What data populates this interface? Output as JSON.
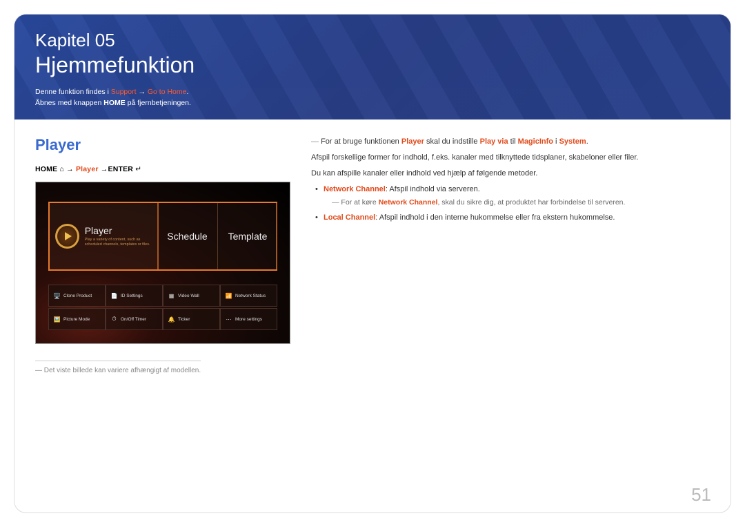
{
  "header": {
    "chapter_prefix": "Kapitel",
    "chapter_number": "05",
    "chapter_title": "Hjemmefunktion",
    "intro_pre": "Denne funktion findes i ",
    "intro_support": "Support",
    "intro_arrow": " → ",
    "intro_goto": "Go to Home",
    "intro_post": ".",
    "sub2_pre": "Åbnes med knappen ",
    "sub2_bold": "HOME",
    "sub2_post": " på fjernbetjeningen."
  },
  "left": {
    "section_title": "Player",
    "path_home": "HOME",
    "path_home_icon": "⌂",
    "path_arrow1": " → ",
    "path_player": "Player",
    "path_arrow2": " →",
    "path_enter": "ENTER",
    "path_enter_icon": "↵",
    "footnote": "Det viste billede kan variere afhængigt af modellen."
  },
  "screenshot": {
    "tiles": {
      "player_name": "Player",
      "player_desc": "Play a variety of content, such as scheduled channels, templates or files.",
      "schedule": "Schedule",
      "template": "Template"
    },
    "grid_row1": [
      {
        "icon": "🖥️",
        "color": "#4aa0e0",
        "label": "Clone Product"
      },
      {
        "icon": "📄",
        "color": "#e06a2a",
        "label": "ID Settings"
      },
      {
        "icon": "▦",
        "color": "#e0c050",
        "label": "Video Wall"
      },
      {
        "icon": "📶",
        "color": "#4a90d0",
        "label": "Network Status"
      }
    ],
    "grid_row2": [
      {
        "icon": "🖼️",
        "color": "#4aa0e0",
        "label": "Picture Mode"
      },
      {
        "icon": "⏱",
        "color": "#50b050",
        "label": "On/Off Timer"
      },
      {
        "icon": "🔔",
        "color": "#d05050",
        "label": "Ticker"
      },
      {
        "icon": "⋯",
        "color": "#9aa0a8",
        "label": "More settings"
      }
    ]
  },
  "right": {
    "note1_pre": "For at bruge funktionen ",
    "note1_player": "Player",
    "note1_mid": " skal du indstille ",
    "note1_playvia": "Play via",
    "note1_til": " til ",
    "note1_magic": "MagicInfo",
    "note1_i": " i ",
    "note1_system": "System",
    "note1_post": ".",
    "para1": "Afspil forskellige former for indhold, f.eks. kanaler med tilknyttede tidsplaner, skabeloner eller filer.",
    "para2": "Du kan afspille kanaler eller indhold ved hjælp af følgende metoder.",
    "bullet1_label": "Network Channel",
    "bullet1_text": ": Afspil indhold via serveren.",
    "bullet1_sub_pre": "For at køre ",
    "bullet1_sub_label": "Network Channel",
    "bullet1_sub_post": ", skal du sikre dig, at produktet har forbindelse til serveren.",
    "bullet2_label": "Local Channel",
    "bullet2_text": ": Afspil indhold i den interne hukommelse eller fra ekstern hukommelse."
  },
  "page_number": "51"
}
